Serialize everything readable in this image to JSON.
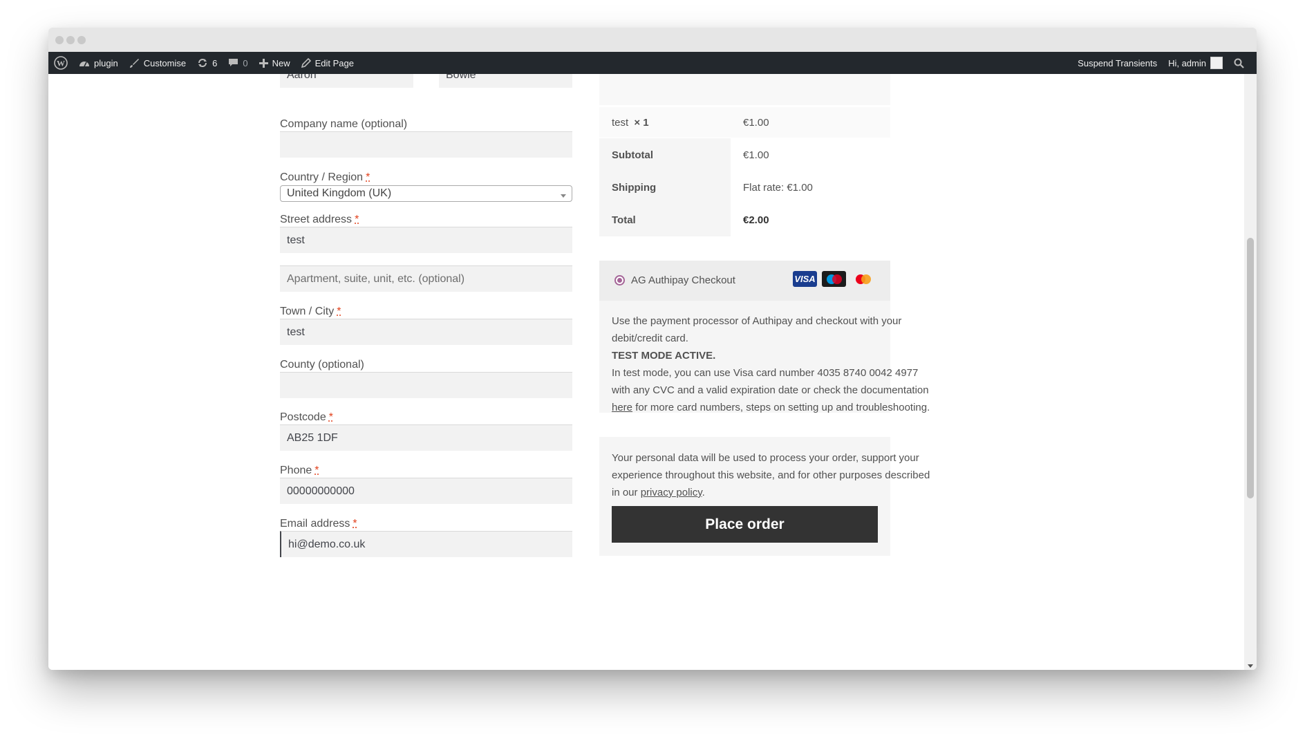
{
  "admin_bar": {
    "site_name": "plugin",
    "customise": "Customise",
    "updates_count": "6",
    "comments_count": "0",
    "new_label": "New",
    "edit_page": "Edit Page",
    "suspend_transients": "Suspend Transients",
    "greeting": "Hi, admin"
  },
  "billing": {
    "first_name_value": "Aaron",
    "last_name_value": "Bowie",
    "company_label": "Company name (optional)",
    "country_label": "Country / Region",
    "country_value": "United Kingdom (UK)",
    "street_label": "Street address",
    "street_value": "test",
    "apartment_placeholder": "Apartment, suite, unit, etc. (optional)",
    "town_label": "Town / City",
    "town_value": "test",
    "county_label": "County (optional)",
    "postcode_label": "Postcode",
    "postcode_value": "AB25 1DF",
    "phone_label": "Phone",
    "phone_value": "00000000000",
    "email_label": "Email address",
    "email_value": "hi@demo.co.uk",
    "required_mark": "*"
  },
  "order_review": {
    "product_name": "test",
    "product_qty": "× 1",
    "product_price": "€1.00",
    "subtotal_label": "Subtotal",
    "subtotal_value": "€1.00",
    "shipping_label": "Shipping",
    "shipping_value": "Flat rate: €1.00",
    "total_label": "Total",
    "total_value": "€2.00"
  },
  "payment": {
    "method_label": "AG Authipay Checkout",
    "card_icons": [
      "VISA",
      "Maestro",
      "Mastercard"
    ],
    "desc_line1": "Use the payment processor of Authipay and checkout with your debit/credit card.",
    "test_mode": "TEST MODE ACTIVE.",
    "desc_line2": "In test mode, you can use Visa card number 4035 8740 0042 4977 with any CVC and a valid expiration date or check the documentation",
    "doc_link": "here",
    "desc_line3": "for more card numbers, steps on setting up and troubleshooting.",
    "privacy_text": "Your personal data will be used to process your order, support your experience throughout this website, and for other purposes described in our",
    "privacy_link": "privacy policy",
    "privacy_end": ".",
    "place_order": "Place order"
  },
  "colors": {
    "admin_bar": "#23282d",
    "button": "#333333",
    "radio_accent": "#a46497",
    "required": "#e2401c"
  }
}
